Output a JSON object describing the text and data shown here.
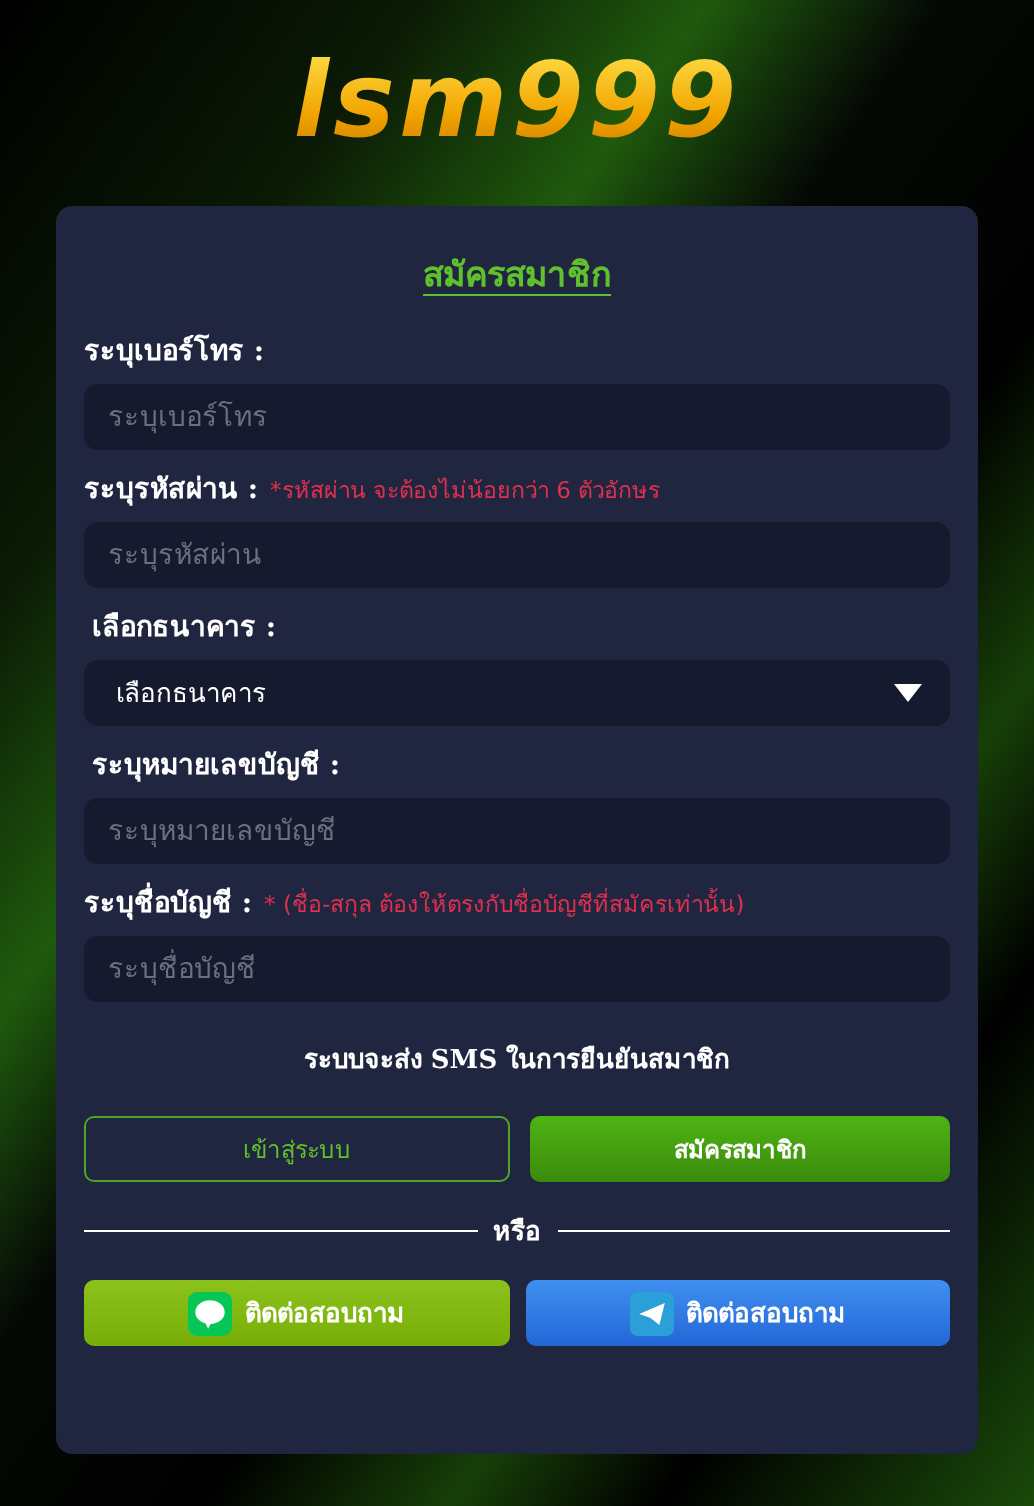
{
  "logo": {
    "text": "lsm999"
  },
  "form": {
    "title": "สมัครสมาชิก",
    "fields": [
      {
        "kind": "input",
        "label": "ระบุเบอร์โทร :",
        "placeholder": "ระบุเบอร์โทร"
      },
      {
        "kind": "input",
        "label": "ระบุรหัสผ่าน :",
        "note": "*รหัสผ่าน จะต้องไม่น้อยกว่า 6 ตัวอักษร",
        "placeholder": "ระบุรหัสผ่าน"
      },
      {
        "kind": "select",
        "label": "เลือกธนาคาร :",
        "value": "เลือกธนาคาร"
      },
      {
        "kind": "input",
        "label": "ระบุหมายเลขบัญชี :",
        "placeholder": "ระบุหมายเลขบัญชี"
      },
      {
        "kind": "input",
        "label": "ระบุชื่อบัญชี :",
        "note": "* (ชื่อ-สกุล ต้องให้ตรงกับชื่อบัญชีที่สมัครเท่านั้น)",
        "placeholder": "ระบุชื่อบัญชี"
      }
    ],
    "sms_notice": "ระบบจะส่ง SMS ในการยืนยันสมาชิก",
    "buttons": [
      {
        "kind": "outline",
        "label": "เข้าสู่ระบบ"
      },
      {
        "kind": "primary",
        "label": "สมัครสมาชิก"
      }
    ],
    "divider": "หรือ",
    "contacts": [
      {
        "kind": "line",
        "label": "ติดต่อสอบถาม"
      },
      {
        "kind": "telegram",
        "label": "ติดต่อสอบถาม"
      }
    ]
  }
}
